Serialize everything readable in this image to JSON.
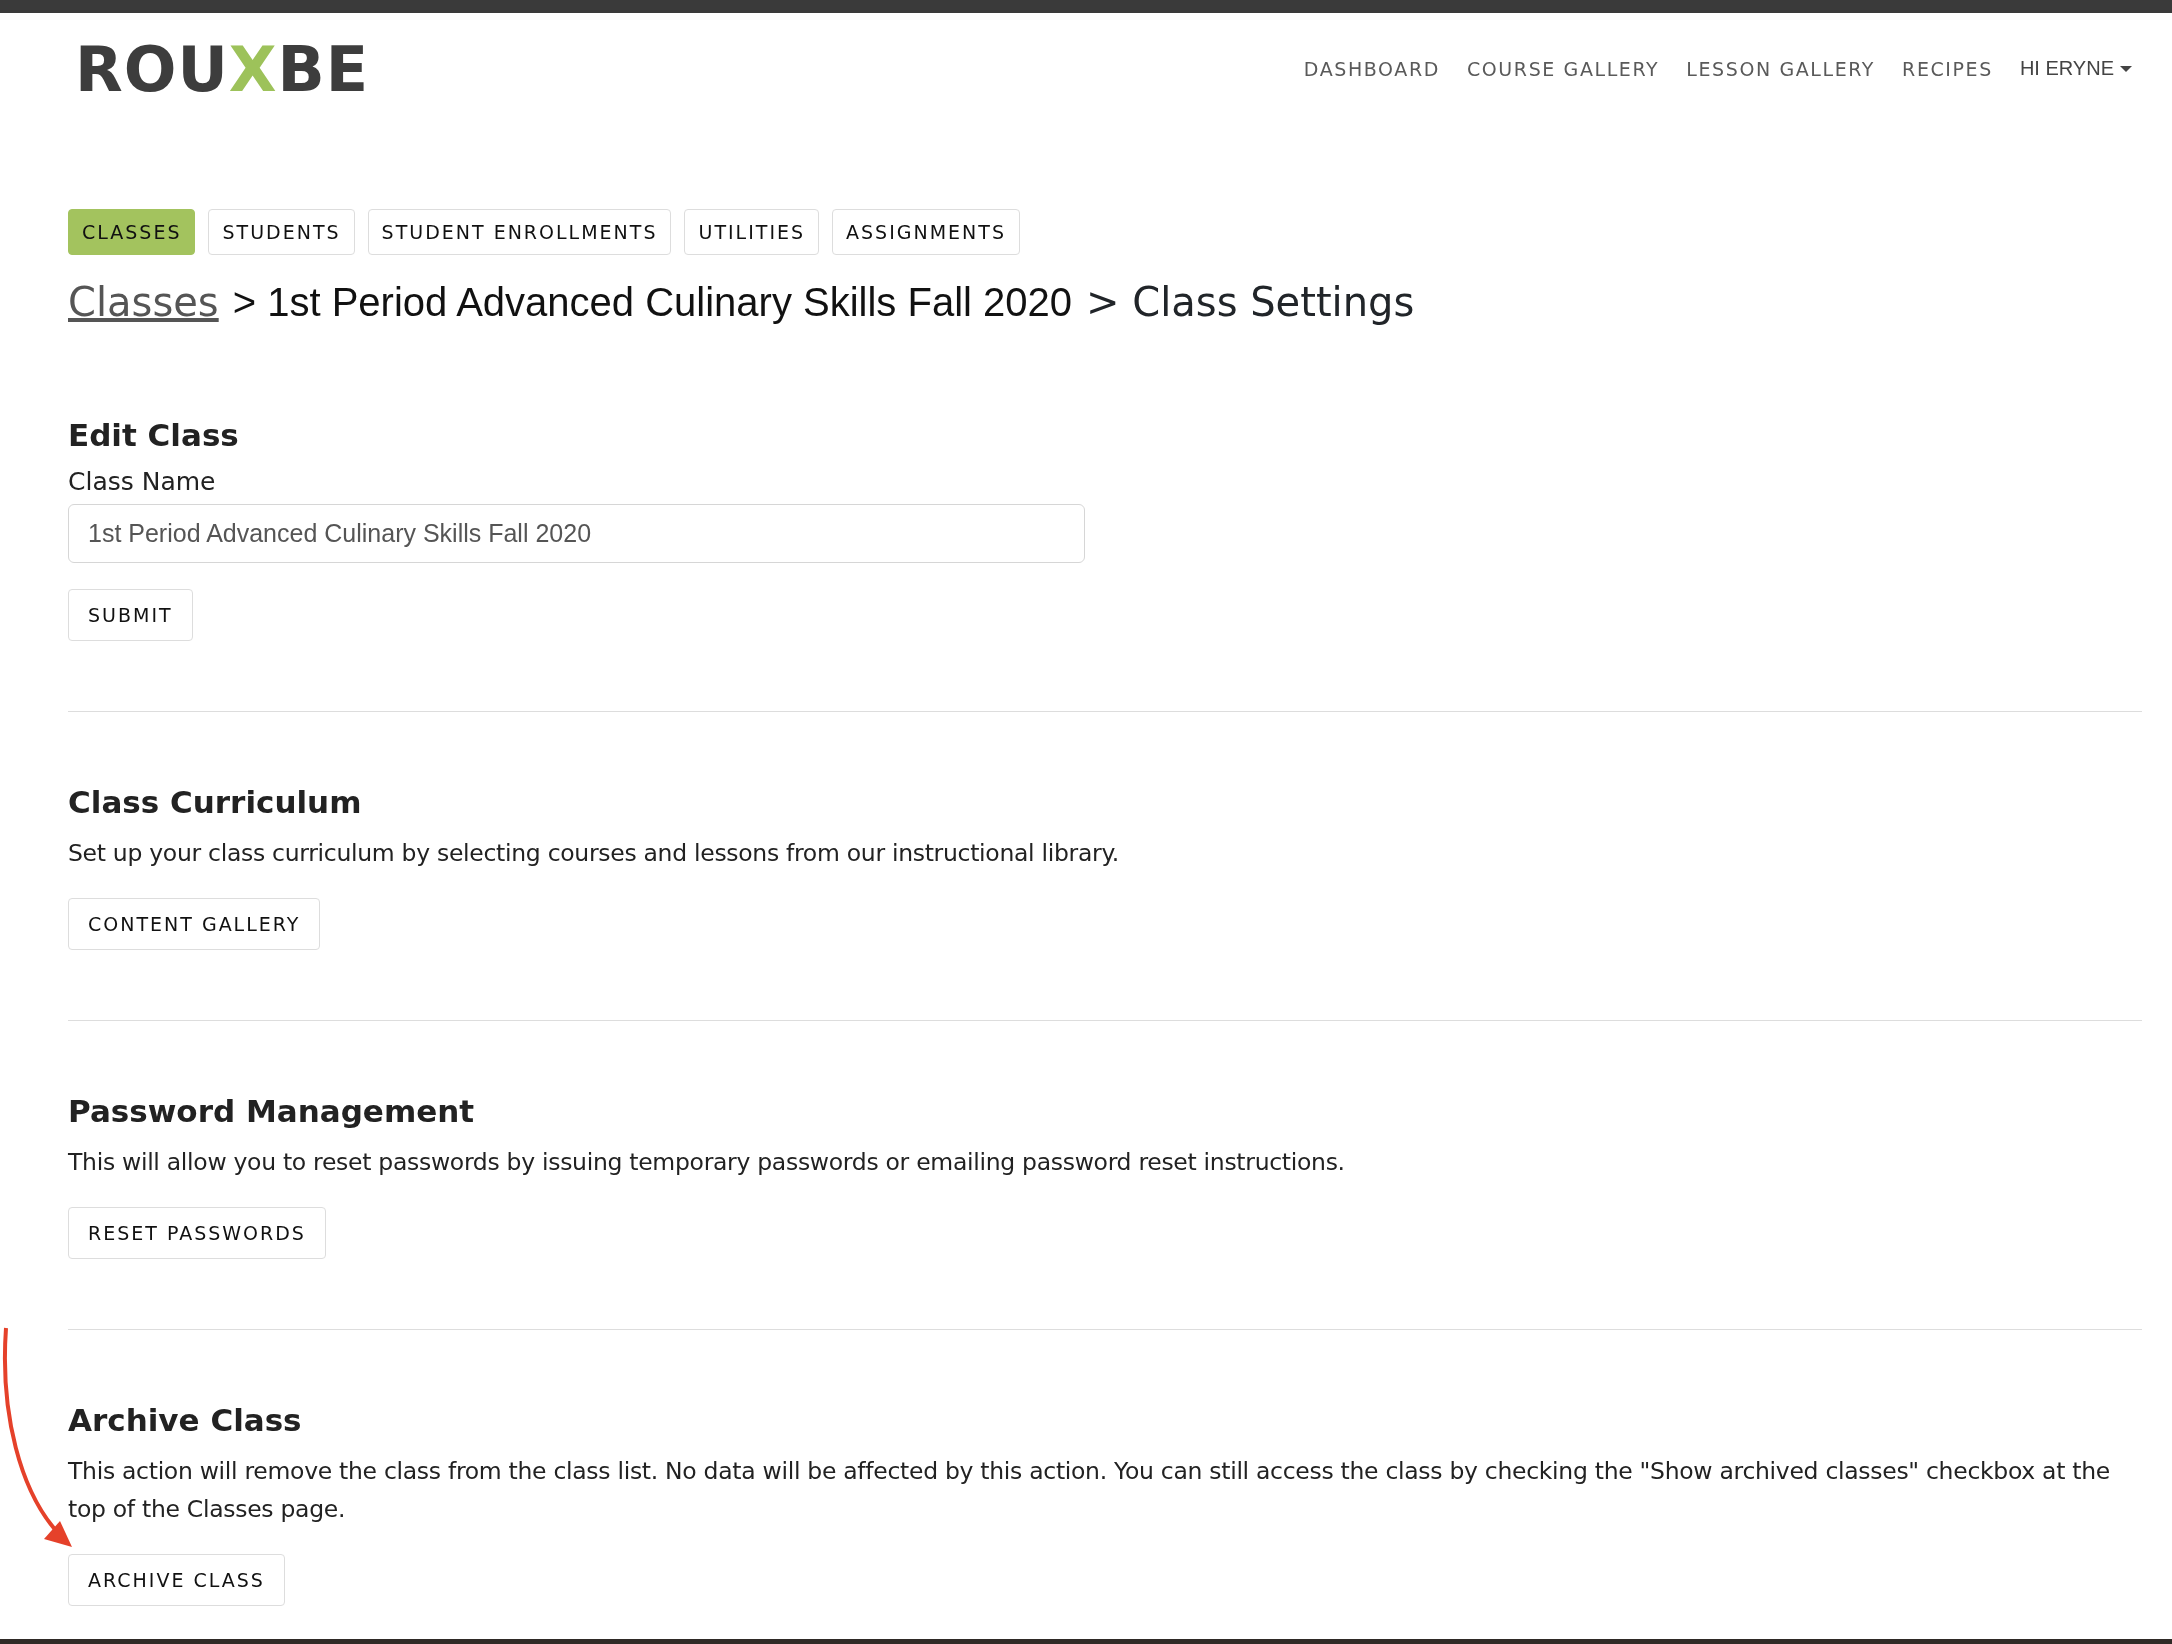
{
  "logo": {
    "parts": [
      {
        "text": "ROU",
        "accent": false
      },
      {
        "text": "X",
        "accent": true
      },
      {
        "text": "BE",
        "accent": false
      }
    ]
  },
  "nav": [
    {
      "label": "DASHBOARD",
      "kind": "link"
    },
    {
      "label": "COURSE GALLERY",
      "kind": "link"
    },
    {
      "label": "LESSON GALLERY",
      "kind": "link"
    },
    {
      "label": "RECIPES",
      "kind": "link"
    },
    {
      "label": "HI ERYNE",
      "kind": "dropdown"
    }
  ],
  "tabs": [
    {
      "label": "CLASSES",
      "selected": true
    },
    {
      "label": "STUDENTS",
      "selected": false
    },
    {
      "label": "STUDENT ENROLLMENTS",
      "selected": false
    },
    {
      "label": "UTILITIES",
      "selected": false
    },
    {
      "label": "ASSIGNMENTS",
      "selected": false
    }
  ],
  "breadcrumb": [
    {
      "text": "Classes",
      "kind": "link"
    },
    {
      "text": "> 1st Period Advanced Culinary Skills Fall 2020",
      "kind": "plain"
    },
    {
      "text": "> Class Settings",
      "kind": "current"
    }
  ],
  "sections": [
    {
      "kind": "form",
      "title": "Edit Class",
      "field_label": "Class Name",
      "value": "1st Period Advanced Culinary Skills Fall 2020",
      "button": "SUBMIT",
      "annotated": false
    },
    {
      "kind": "action",
      "title": "Class Curriculum",
      "description": "Set up your class curriculum by selecting courses and lessons from our instructional library.",
      "button": "CONTENT GALLERY",
      "annotated": false
    },
    {
      "kind": "action",
      "title": "Password Management",
      "description": "This will allow you to reset passwords by issuing temporary passwords or emailing password reset instructions.",
      "button": "RESET PASSWORDS",
      "annotated": false
    },
    {
      "kind": "action",
      "title": "Archive Class",
      "description": "This action will remove the class from the class list. No data will be affected by this action. You can still access the class by checking the \"Show archived classes\" checkbox at the top of the Classes page.",
      "button": "ARCHIVE CLASS",
      "annotated": true
    }
  ]
}
